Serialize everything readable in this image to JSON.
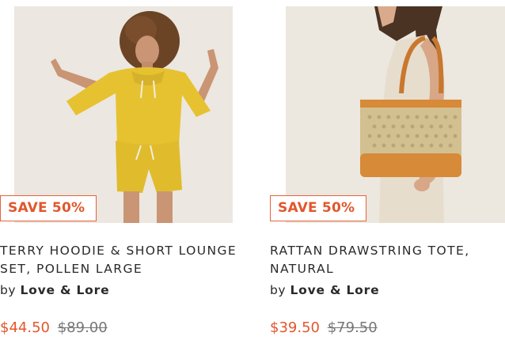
{
  "products": [
    {
      "image_alt": "woman-in-yellow-hoodie-and-shorts",
      "badge": "SAVE 50%",
      "title": "TERRY HOODIE & SHORT LOUNGE SET, POLLEN LARGE",
      "by_label": "by",
      "vendor": "Love & Lore",
      "sale_price": "$44.50",
      "compare_price": "$89.00"
    },
    {
      "image_alt": "rattan-tote-on-shoulder",
      "badge": "SAVE 50%",
      "title": "RATTAN DRAWSTRING TOTE, NATURAL",
      "by_label": "by",
      "vendor": "Love & Lore",
      "sale_price": "$39.50",
      "compare_price": "$79.50"
    }
  ],
  "colors": {
    "accent": "#e2572c",
    "text": "#2a2a2a",
    "muted": "#777777",
    "photo_bg": "#ede7df"
  }
}
